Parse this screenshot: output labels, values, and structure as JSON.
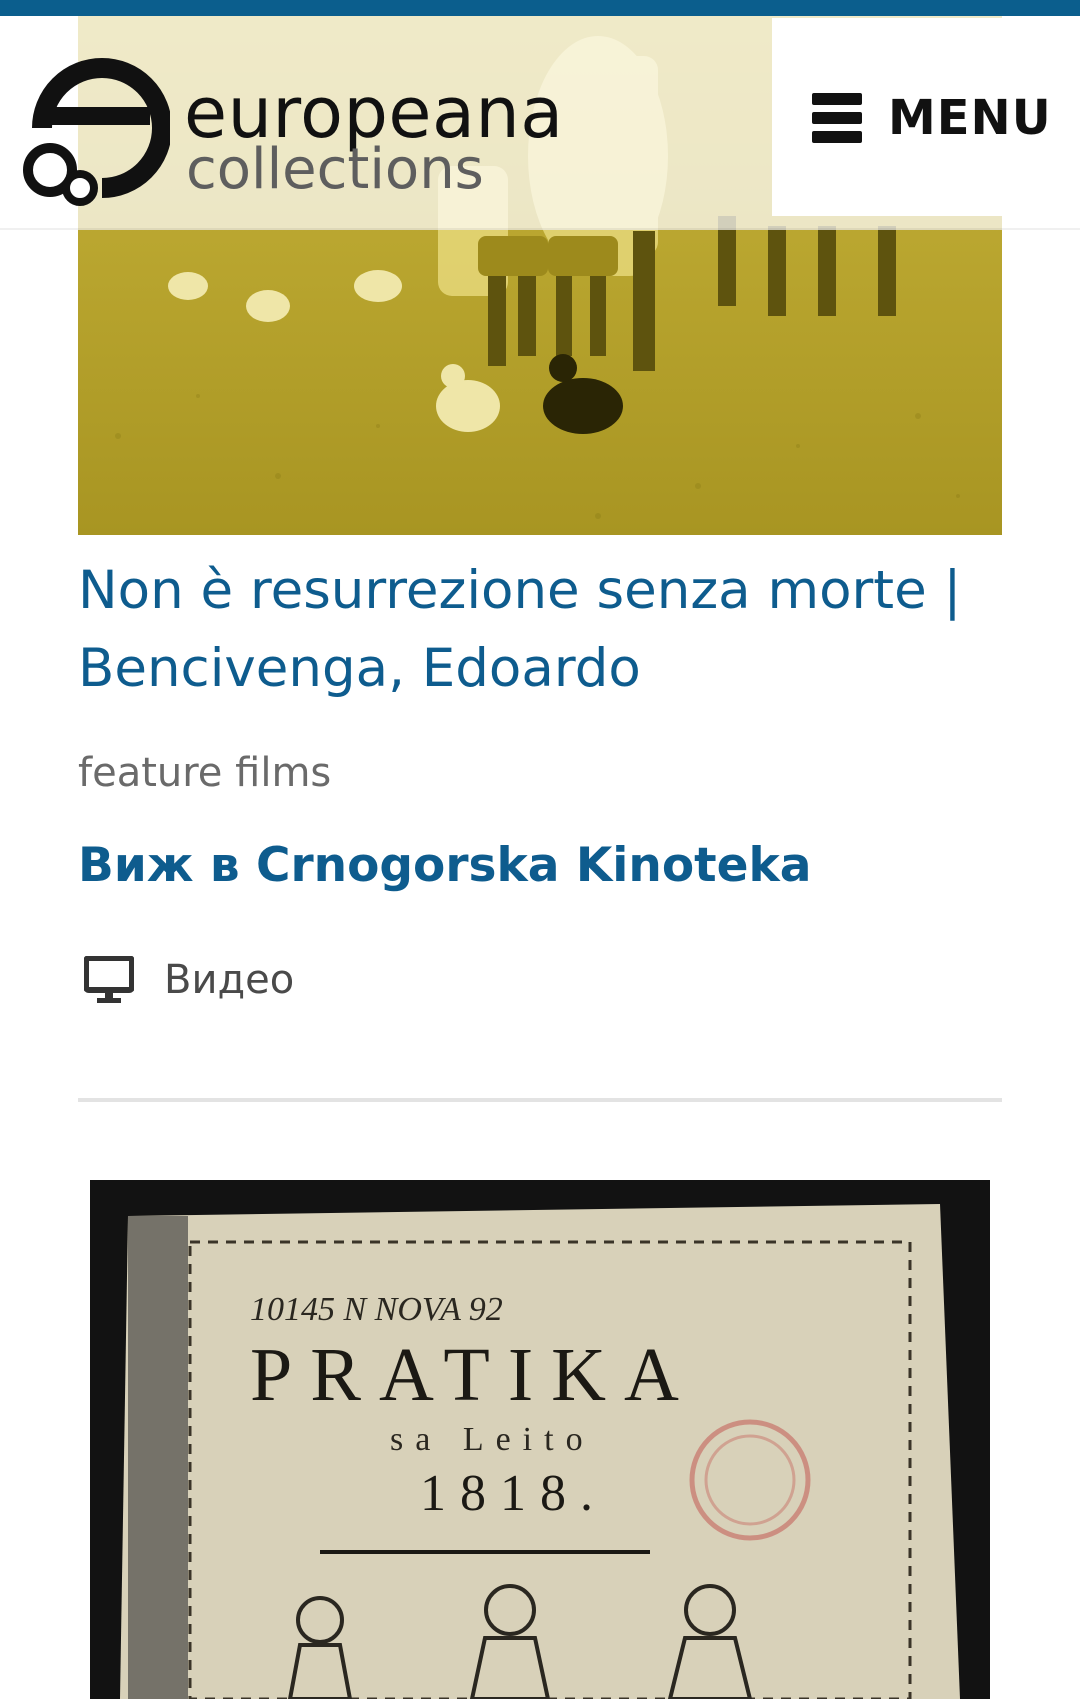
{
  "header": {
    "logo_text_line1": "europeana",
    "logo_text_line2": "collections",
    "menu_label": "MENU"
  },
  "card1": {
    "title_line1": "Non è resurrezione senza morte |",
    "title_line2": "Bencivenga, Edoardo",
    "type": "feature films",
    "provider_link": "Виж в Crnogorska Kinoteka",
    "media_icon": "monitor-icon",
    "media_label": "Видео"
  },
  "card2": {
    "image_text_top": "10145 N NOVA 92",
    "image_text_title": "PRATIKA",
    "image_text_sub": "sa Leito",
    "image_text_year": "1818."
  },
  "colors": {
    "accent": "#0e5c8e",
    "top_bar": "#0b5e8d",
    "hero_tint": "#b5a32a"
  }
}
